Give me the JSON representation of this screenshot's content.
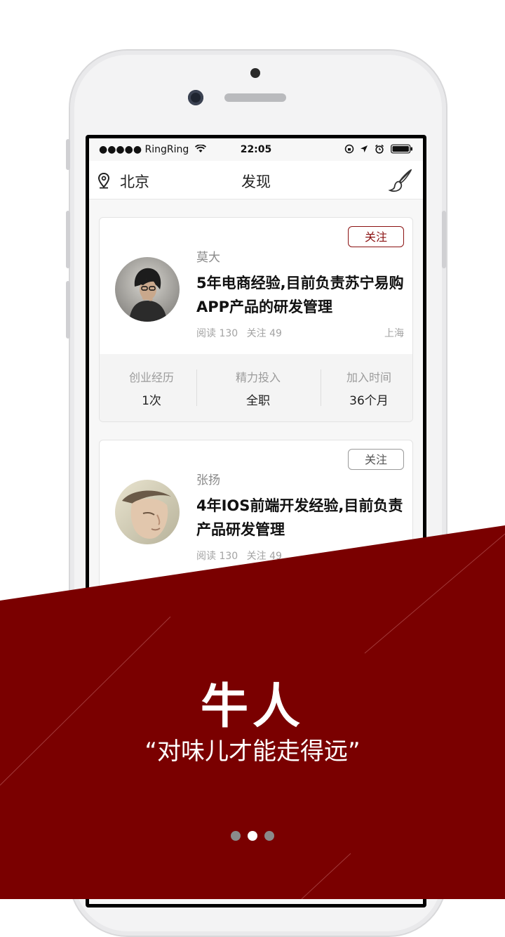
{
  "status_bar": {
    "carrier": "●●●●● RingRing",
    "time": "22:05"
  },
  "nav": {
    "city": "北京",
    "title": "发现",
    "city_icon": "location-pin-icon",
    "right_icon": "brush-icon"
  },
  "cards": [
    {
      "follow_label": "关注",
      "follow_state": "active",
      "name": "莫大",
      "desc": "5年电商经验,目前负责苏宁易购APP产品的研发管理",
      "reads": "阅读 130",
      "follows": "关注 49",
      "location": "上海",
      "stats": [
        {
          "label": "创业经历",
          "value": "1次"
        },
        {
          "label": "精力投入",
          "value": "全职"
        },
        {
          "label": "加入时间",
          "value": "36个月"
        }
      ]
    },
    {
      "follow_label": "关注",
      "follow_state": "inactive",
      "name": "张扬",
      "desc": "4年IOS前端开发经验,目前负责产品研发管理",
      "reads": "阅读 130",
      "follows": "关注 49"
    }
  ],
  "banner": {
    "headline": "牛人",
    "tagline": "“对味儿才能走得远”",
    "color": "#7a0000"
  },
  "pager": {
    "count": 3,
    "active_index": 1
  }
}
